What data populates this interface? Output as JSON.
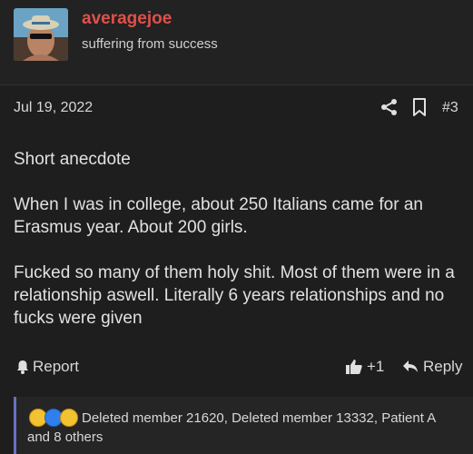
{
  "user": {
    "name": "averagejoe",
    "title": "suffering from success"
  },
  "post": {
    "date": "Jul 19, 2022",
    "number": "#3",
    "paragraphs": [
      "Short anecdote",
      "When I was in college, about 250 Italians came for an Erasmus year. About 200 girls.",
      "Fucked so many of them holy shit. Most of them were in a relationship aswell. Literally 6 years relationships and no fucks were given"
    ]
  },
  "footer": {
    "report_label": "Report",
    "like_count": "+1",
    "reply_label": "Reply"
  },
  "reactions": {
    "icons": [
      "laugh-emoji-icon",
      "like-emoji-icon",
      "wow-emoji-icon"
    ],
    "text": "Deleted member 21620, Deleted member 13332, Patient A and 8 others"
  },
  "colors": {
    "username": "#e0504b",
    "accent": "#6a6fc2"
  }
}
